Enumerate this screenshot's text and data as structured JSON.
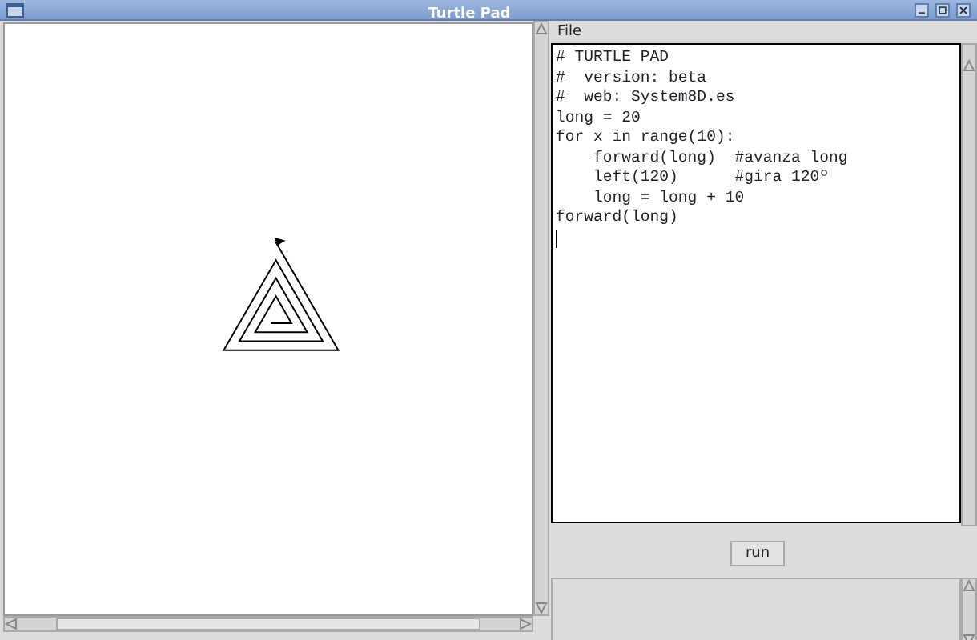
{
  "window": {
    "title": "Turtle Pad"
  },
  "menu": [
    "File"
  ],
  "editor": {
    "lines": [
      "# TURTLE PAD",
      "#  version: beta",
      "#  web: System8D.es",
      "long = 20",
      "for x in range(10):",
      "    forward(long)  #avanza long",
      "    left(120)      #gira 120º",
      "    long = long + 10",
      "forward(long)"
    ]
  },
  "run_button": {
    "label": "run"
  }
}
